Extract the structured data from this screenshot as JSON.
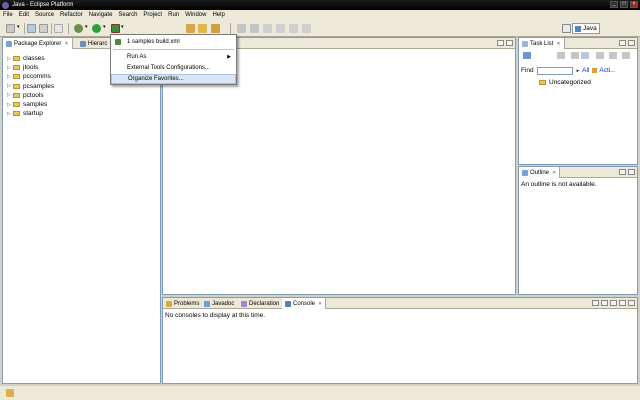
{
  "window": {
    "title": "Java - Eclipse Platform"
  },
  "menubar": [
    "File",
    "Edit",
    "Source",
    "Refactor",
    "Navigate",
    "Search",
    "Project",
    "Run",
    "Window",
    "Help"
  ],
  "perspective": {
    "label": "Java"
  },
  "explorer": {
    "tabs": [
      "Package Explorer",
      "Hierarc"
    ],
    "items": [
      "classes",
      "jtools",
      "pccomms",
      "pcsamples",
      "pctools",
      "samples",
      "startup"
    ]
  },
  "run_menu": {
    "items": [
      "1 samples build.xml",
      "Run As",
      "External Tools Configurations...",
      "Organize Favorites..."
    ]
  },
  "task_list": {
    "tab": "Task List",
    "find_label": "Find",
    "all_label": "All",
    "activate_label": "Acti...",
    "category": "Uncategorized"
  },
  "outline": {
    "tab": "Outline",
    "message": "An outline is not available."
  },
  "bottom": {
    "tabs": [
      "Problems",
      "Javadoc",
      "Declaration",
      "Console"
    ],
    "console_message": "No consoles to display at this time."
  },
  "colors": {
    "title_bar": "#000000",
    "chrome": "#ece9d8",
    "pane_border": "#7f9db9",
    "menu_highlight": "#dbe6f5"
  }
}
